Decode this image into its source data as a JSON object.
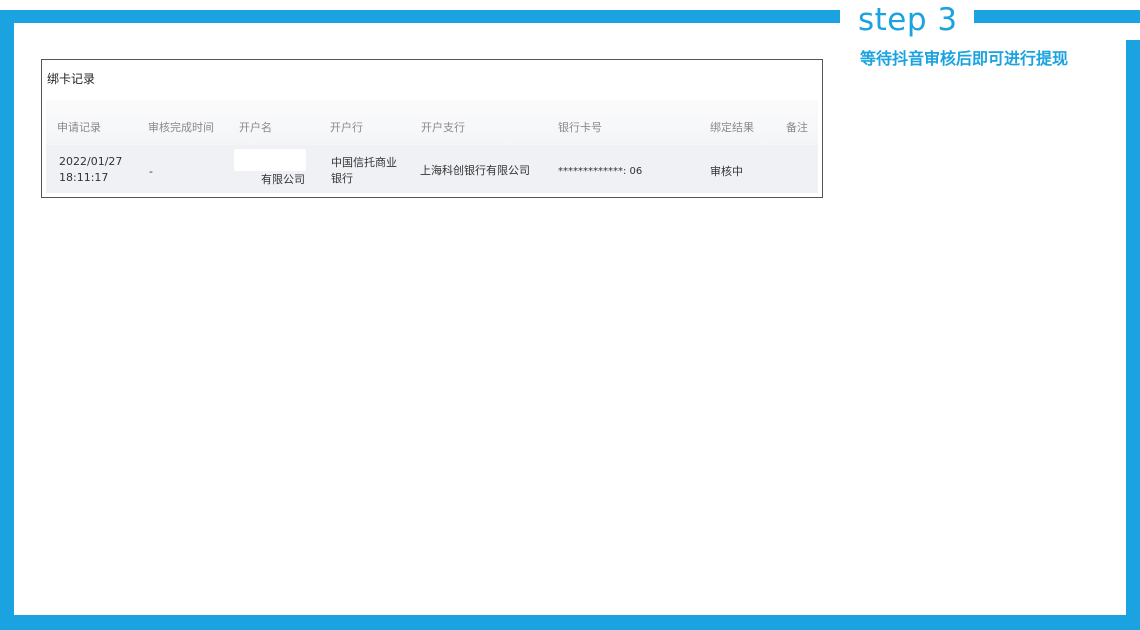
{
  "step": {
    "title": "step 3",
    "description": "等待抖音审核后即可进行提现"
  },
  "card": {
    "title": "绑卡记录",
    "columns": [
      "申请记录",
      "审核完成时间",
      "开户名",
      "开户行",
      "开户支行",
      "银行卡号",
      "绑定结果",
      "备注"
    ],
    "rows": [
      {
        "apply_date": "2022/01/27",
        "apply_time": "18:11:17",
        "review_time": "-",
        "account_name": "有限公司",
        "bank_line1": "中国信托商业",
        "bank_line2": "银行",
        "branch": "上海科创银行有限公司",
        "card_number": "*************: 06",
        "result": "审核中",
        "remark": ""
      }
    ]
  },
  "colors": {
    "accent": "#1aa3e0"
  }
}
